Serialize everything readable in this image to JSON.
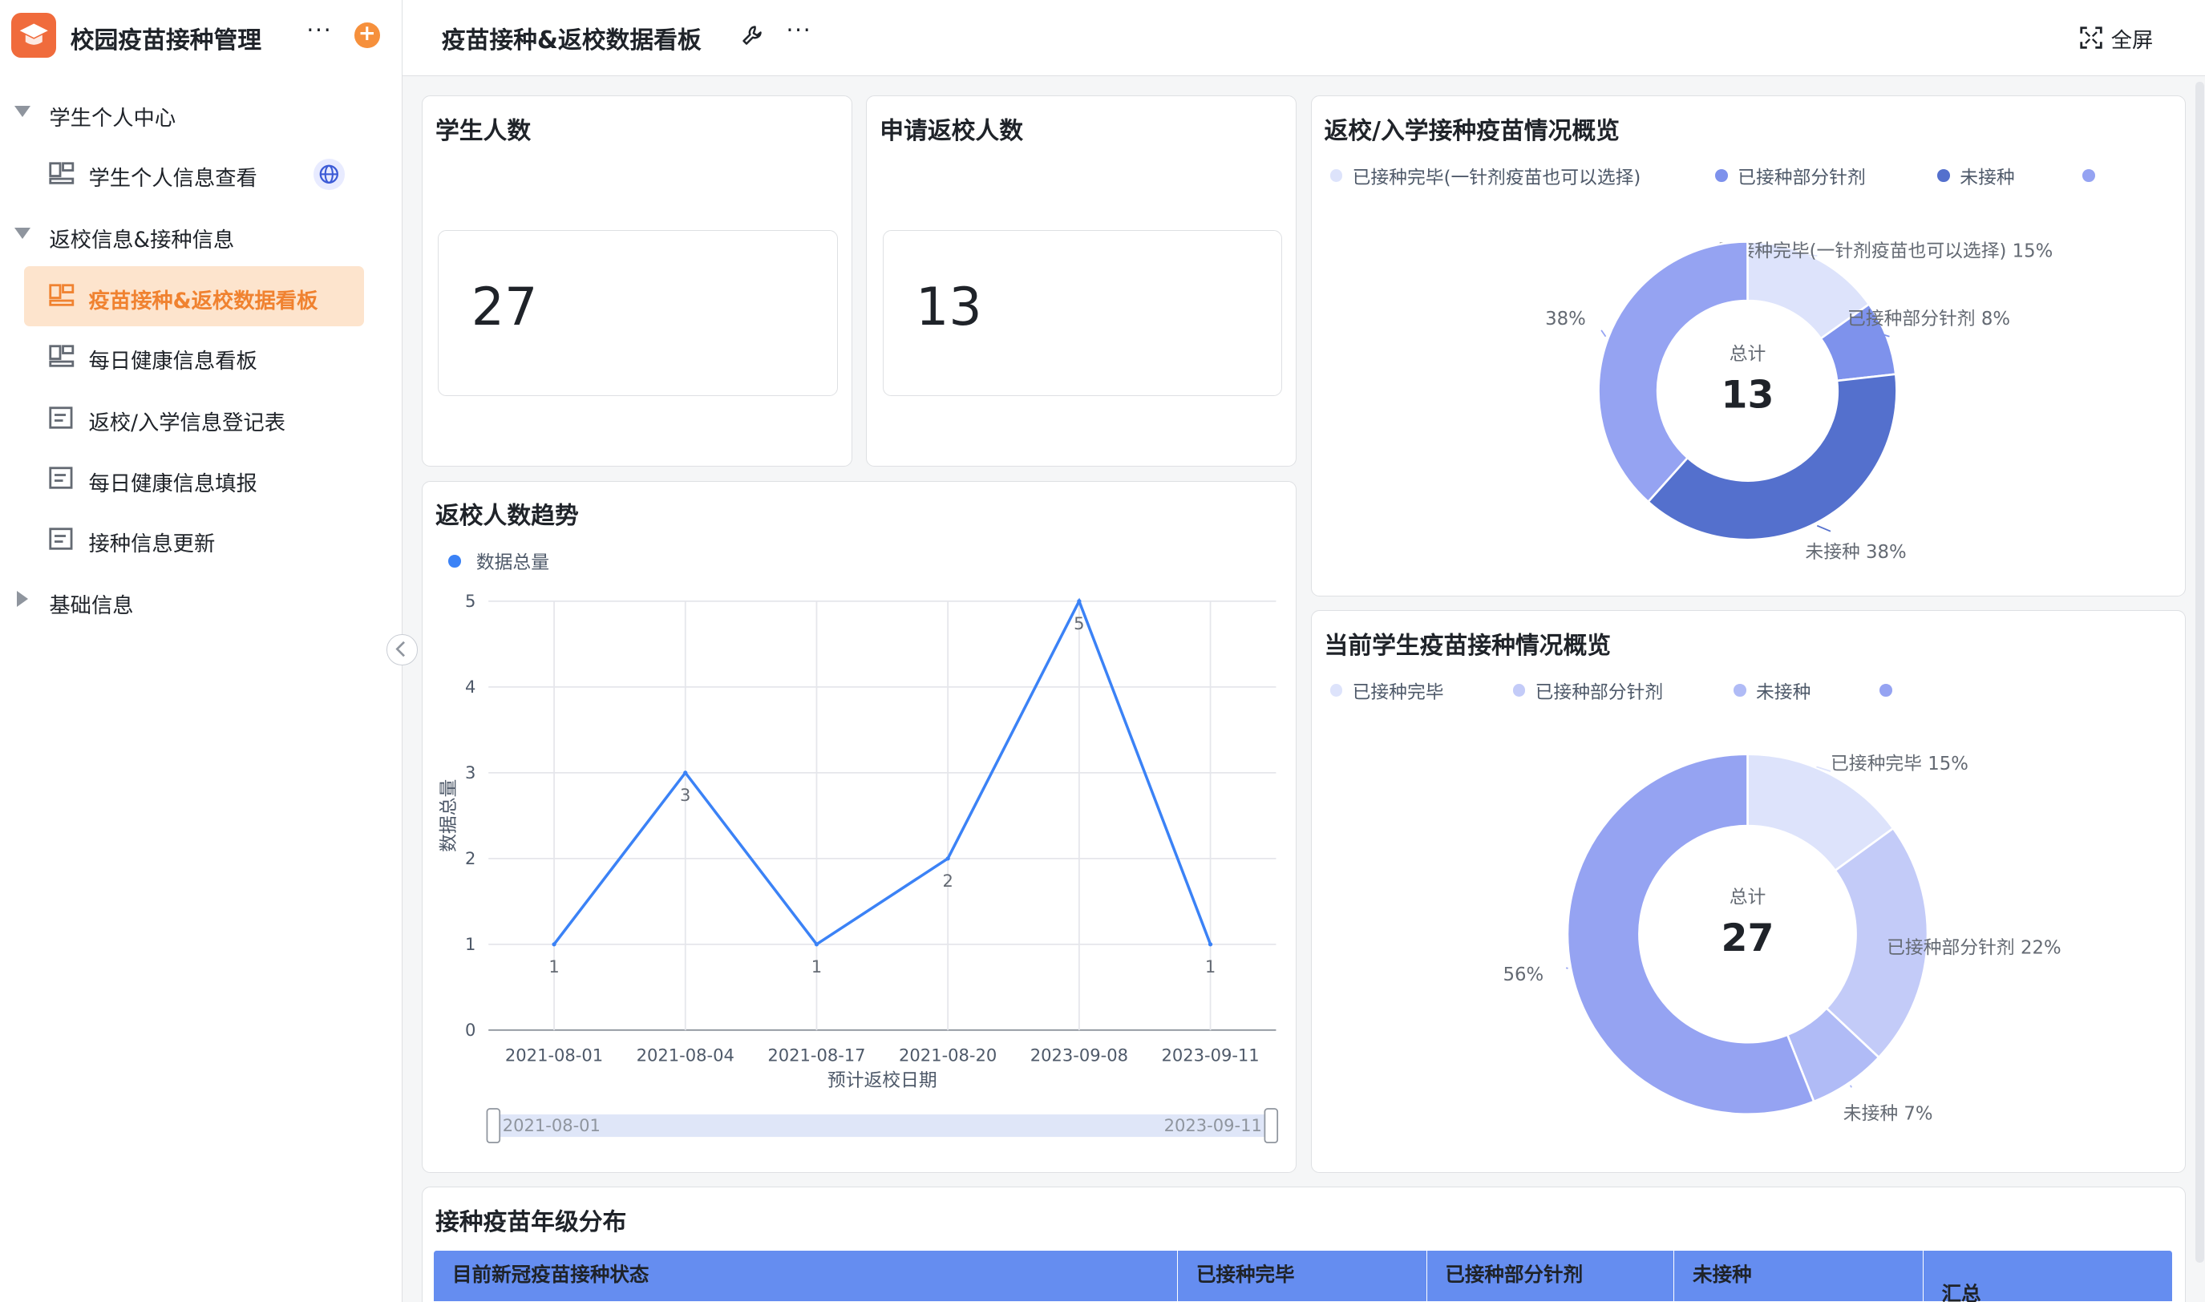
{
  "app": {
    "title": "校园疫苗接种管理",
    "more": "···",
    "add": "+"
  },
  "sidebar": {
    "groups": [
      {
        "label": "学生个人中心"
      },
      {
        "label": "返校信息&接种信息"
      },
      {
        "label": "基础信息"
      }
    ],
    "items": [
      {
        "label": "学生个人信息查看",
        "icon": "dashboard-icon"
      },
      {
        "label": "疫苗接种&返校数据看板",
        "icon": "dashboard-icon"
      },
      {
        "label": "每日健康信息看板",
        "icon": "dashboard-icon"
      },
      {
        "label": "返校/入学信息登记表",
        "icon": "form-icon"
      },
      {
        "label": "每日健康信息填报",
        "icon": "form-icon"
      },
      {
        "label": "接种信息更新",
        "icon": "form-icon"
      }
    ]
  },
  "header": {
    "title": "疫苗接种&返校数据看板",
    "more": "···",
    "fullscreen": "全屏"
  },
  "stats": [
    {
      "title": "学生人数",
      "value": "27"
    },
    {
      "title": "申请返校人数",
      "value": "13"
    }
  ],
  "colors": {
    "accent": "#f08230",
    "line": "#3b82f6",
    "table_header": "#658df0"
  },
  "trend": {
    "title": "返校人数趋势",
    "slider_start": "2021-08-01",
    "slider_end": "2023-09-11"
  },
  "donut1": {
    "title": "返校/入学接种疫苗情况概览",
    "center_label": "总计",
    "center_value": "13",
    "slice_labels": [
      "已接种完毕(一针剂疫苗也可以选择) 15%",
      "已接种部分针剂 8%",
      "未接种 38%",
      "38%"
    ]
  },
  "donut2": {
    "title": "当前学生疫苗接种情况概览",
    "center_label": "总计",
    "center_value": "27",
    "slice_labels": [
      "已接种完毕 15%",
      "已接种部分针剂 22%",
      "未接种 7%",
      "56%"
    ]
  },
  "table": {
    "title": "接种疫苗年级分布",
    "headers": [
      "目前新冠疫苗接种状态",
      "已接种完毕",
      "已接种部分针剂",
      "未接种",
      "汇总"
    ]
  },
  "chart_data": [
    {
      "type": "line",
      "title": "返校人数趋势",
      "xlabel": "预计返校日期",
      "ylabel": "数据总量",
      "legend": "top-left",
      "grid": true,
      "ylim": [
        0,
        5
      ],
      "yticks": [
        "0",
        "1",
        "2",
        "3",
        "4",
        "5"
      ],
      "categories": [
        "2021-08-01",
        "2021-08-04",
        "2021-08-17",
        "2021-08-20",
        "2023-09-08",
        "2023-09-11"
      ],
      "series": [
        {
          "name": "数据总量",
          "values": [
            1,
            3,
            1,
            2,
            5,
            1
          ],
          "color": "#3b82f6"
        }
      ]
    },
    {
      "type": "pie",
      "title": "返校/入学接种疫苗情况概览",
      "legend": "top",
      "categories": [
        "已接种完毕(一针剂疫苗也可以选择)",
        "已接种部分针剂",
        "未接种",
        ""
      ],
      "values": [
        15,
        8,
        38,
        38
      ],
      "colors": [
        "#dde3fb",
        "#7e92ec",
        "#5470cd",
        "#95a3f2"
      ],
      "total": 13
    },
    {
      "type": "pie",
      "title": "当前学生疫苗接种情况概览",
      "legend": "top",
      "categories": [
        "已接种完毕",
        "已接种部分针剂",
        "未接种",
        ""
      ],
      "values": [
        15,
        22,
        7,
        56
      ],
      "colors": [
        "#dde3fb",
        "#c3cbf8",
        "#b0bbf6",
        "#95a3f2"
      ],
      "total": 27
    }
  ]
}
